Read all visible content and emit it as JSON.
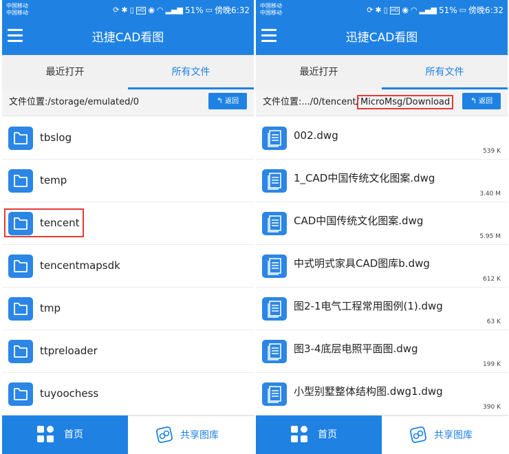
{
  "left": {
    "status": {
      "carrier1": "中国移动",
      "carrier2": "中国移动",
      "battery": "51%",
      "time": "傍晚6:32"
    },
    "app_title": "迅捷CAD看图",
    "tabs": [
      "最近打开",
      "所有文件"
    ],
    "path_label": "文件位置:/storage/emulated/0",
    "back_label": "返回",
    "items": [
      "tbslog",
      "temp",
      "tencent",
      "tencentmapsdk",
      "tmp",
      "ttpreloader",
      "tuyoochess"
    ],
    "nav": {
      "home": "首页",
      "share": "共享图库"
    }
  },
  "right": {
    "status": {
      "carrier1": "中国移动",
      "carrier2": "中国移动",
      "battery": "51%",
      "time": "傍晚6:32"
    },
    "app_title": "迅捷CAD看图",
    "tabs": [
      "最近打开",
      "所有文件"
    ],
    "path_prefix": "文件位置:.../0/tencent/",
    "path_highlight": "MicroMsg/Download",
    "back_label": "返回",
    "files": [
      {
        "name": "002.dwg",
        "size": "539 K"
      },
      {
        "name": "1_CAD中国传统文化图案.dwg",
        "size": "3.40 M"
      },
      {
        "name": "CAD中国传统文化图案.dwg",
        "size": "5.95 M"
      },
      {
        "name": "中式明式家具CAD图库b.dwg",
        "size": "612 K"
      },
      {
        "name": "图2-1电气工程常用图例(1).dwg",
        "size": "63 K"
      },
      {
        "name": "图3-4底层电照平面图.dwg",
        "size": "199 K"
      },
      {
        "name": "小型别墅整体结构图.dwg1.dwg",
        "size": "390 K"
      }
    ],
    "nav": {
      "home": "首页",
      "share": "共享图库"
    }
  },
  "colors": {
    "primary": "#1f82e3",
    "highlight": "#e53935"
  }
}
